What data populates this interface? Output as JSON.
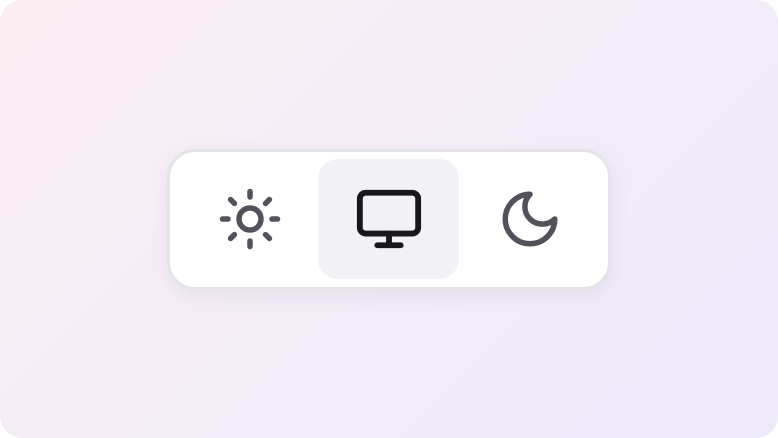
{
  "theme_switcher": {
    "selected": "system",
    "options": [
      {
        "id": "light",
        "icon": "sun-icon",
        "label": ""
      },
      {
        "id": "system",
        "icon": "monitor-icon",
        "label": ""
      },
      {
        "id": "dark",
        "icon": "moon-icon",
        "label": ""
      }
    ]
  },
  "colors": {
    "icon_inactive": "#52525b",
    "icon_active": "#18181b",
    "active_bg": "#f2f2f6",
    "panel_bg": "#ffffff",
    "panel_border": "#e4e3e8"
  }
}
